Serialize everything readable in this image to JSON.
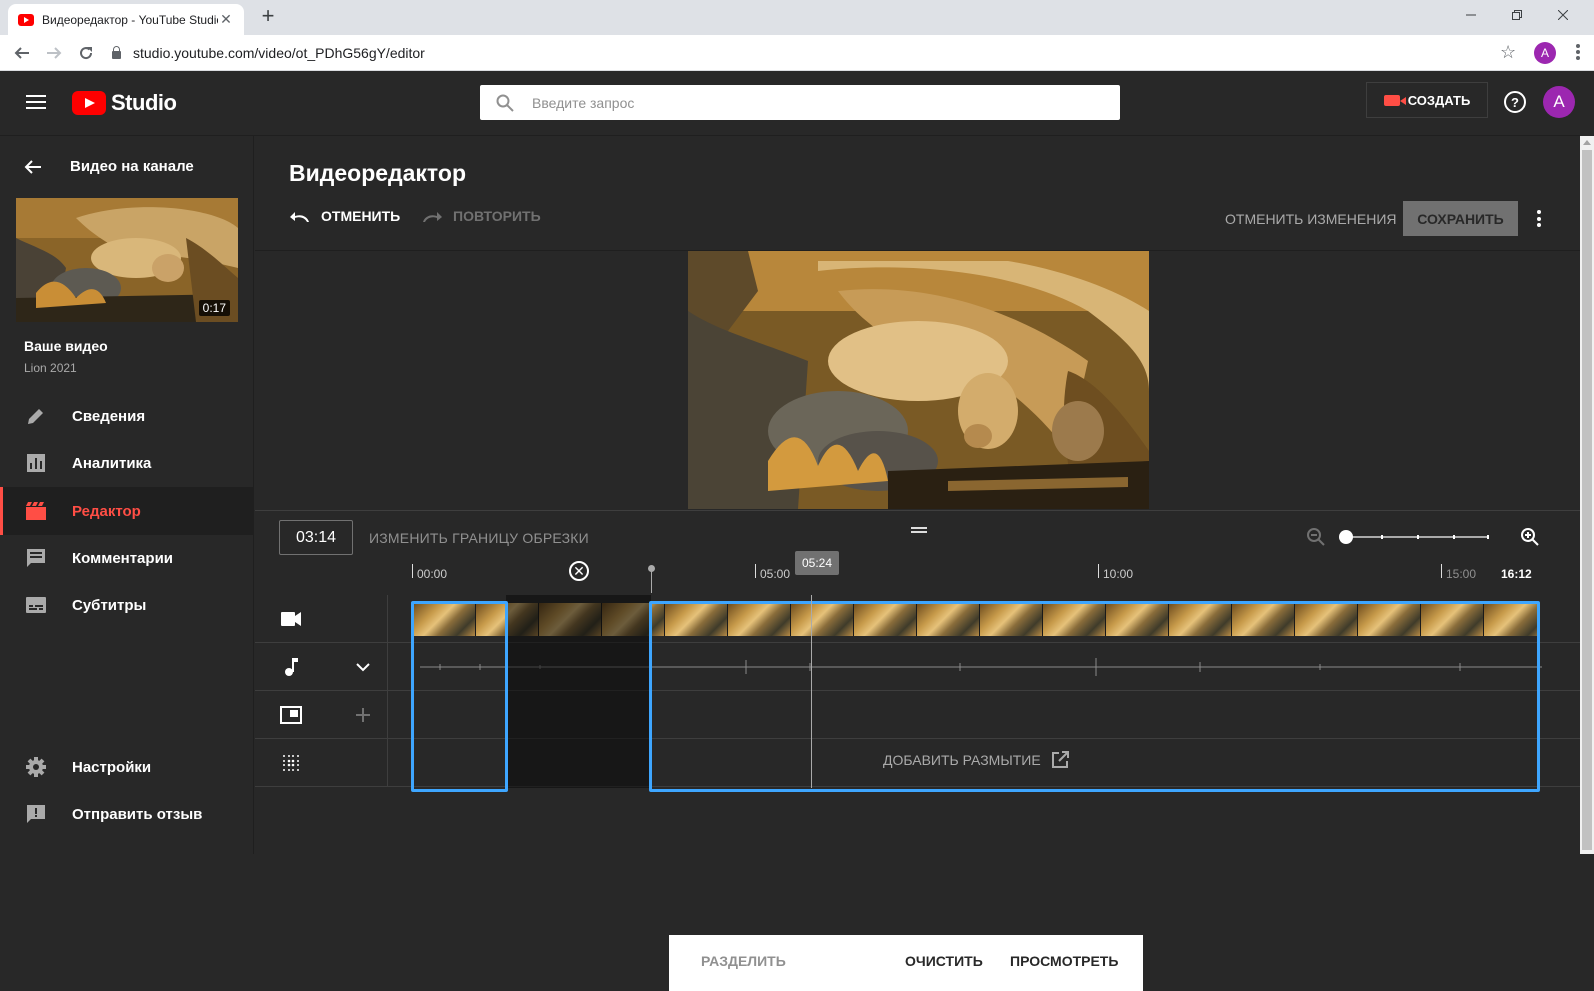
{
  "browser": {
    "tab_title": "Видеоредактор - YouTube Studio",
    "url": "studio.youtube.com/video/ot_PDhG56gY/editor",
    "profile_initial": "A"
  },
  "header": {
    "logo_text": "Studio",
    "search_placeholder": "Введите запрос",
    "create_label": "СОЗДАТЬ",
    "help_glyph": "?",
    "avatar_initial": "A"
  },
  "sidebar": {
    "back_label": "Видео на канале",
    "thumbnail_duration": "0:17",
    "your_video_label": "Ваше видео",
    "video_title": "Lion 2021",
    "items": [
      {
        "label": "Сведения",
        "icon": "pencil-icon"
      },
      {
        "label": "Аналитика",
        "icon": "analytics-icon"
      },
      {
        "label": "Редактор",
        "icon": "editor-clapper-icon",
        "active": true
      },
      {
        "label": "Комментарии",
        "icon": "comments-icon"
      },
      {
        "label": "Субтитры",
        "icon": "subtitles-icon"
      }
    ],
    "bottom_items": [
      {
        "label": "Настройки",
        "icon": "gear-icon"
      },
      {
        "label": "Отправить отзыв",
        "icon": "feedback-icon"
      }
    ]
  },
  "editor": {
    "title": "Видеоредактор",
    "undo_label": "ОТМЕНИТЬ",
    "redo_label": "ПОВТОРИТЬ",
    "discard_label": "ОТМЕНИТЬ ИЗМЕНЕНИЯ",
    "save_label": "СОХРАНИТЬ",
    "current_time": "03:14",
    "trim_label": "ИЗМЕНИТЬ ГРАНИЦУ ОБРЕЗКИ",
    "playhead_time": "05:24",
    "ruler": [
      "00:00",
      "05:00",
      "10:00",
      "15:00",
      "16:12"
    ],
    "blur_label": "ДОБАВИТЬ РАЗМЫТИЕ",
    "actions": {
      "split_label": "РАЗДЕЛИТЬ",
      "clear_label": "ОЧИСТИТЬ",
      "preview_label": "ПРОСМОТРЕТЬ"
    },
    "accent_color": "#3ea6ff",
    "active_color": "#ff4e45"
  }
}
